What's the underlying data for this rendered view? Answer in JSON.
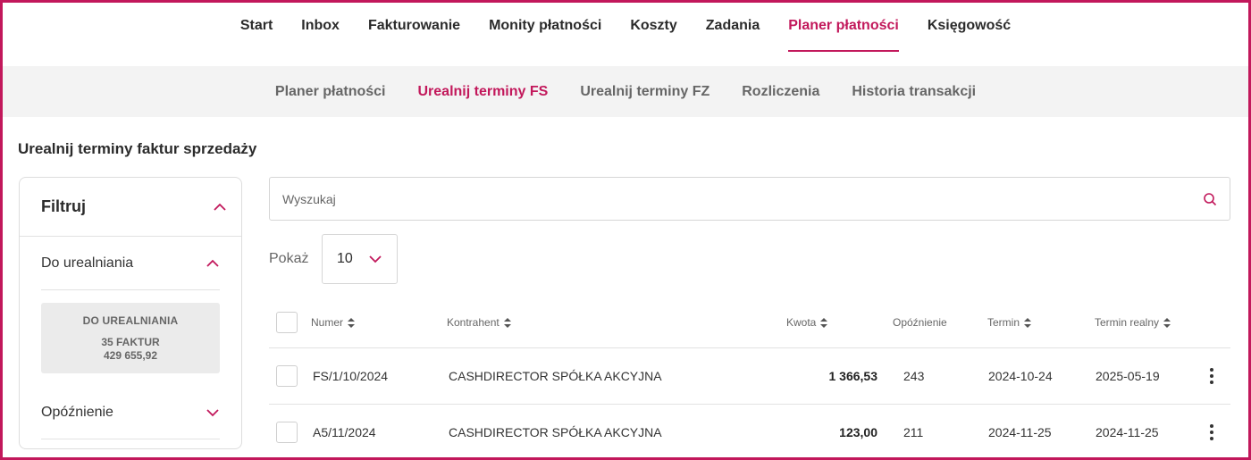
{
  "top_nav": [
    {
      "label": "Start"
    },
    {
      "label": "Inbox"
    },
    {
      "label": "Fakturowanie"
    },
    {
      "label": "Monity płatności"
    },
    {
      "label": "Koszty"
    },
    {
      "label": "Zadania"
    },
    {
      "label": "Planer płatności",
      "active": true
    },
    {
      "label": "Księgowość"
    }
  ],
  "sub_nav": [
    {
      "label": "Planer płatności"
    },
    {
      "label": "Urealnij terminy FS",
      "active": true
    },
    {
      "label": "Urealnij terminy FZ"
    },
    {
      "label": "Rozliczenia"
    },
    {
      "label": "Historia transakcji"
    }
  ],
  "page_title": "Urealnij terminy faktur sprzedaży",
  "filter": {
    "title": "Filtruj",
    "sections": {
      "do_urealniania": {
        "label": "Do urealniania",
        "expanded": true
      },
      "opoznienie": {
        "label": "Opóźnienie",
        "expanded": false
      }
    },
    "summary": {
      "title": "DO UREALNIANIA",
      "count": "35 FAKTUR",
      "amount": "429 655,92"
    }
  },
  "search": {
    "placeholder": "Wyszukaj",
    "value": "",
    "icon": "search-icon"
  },
  "page_size": {
    "label": "Pokaż",
    "value": "10"
  },
  "table": {
    "columns": {
      "number": "Numer",
      "contractor": "Kontrahent",
      "amount": "Kwota",
      "delay": "Opóźnienie",
      "term": "Termin",
      "real_term": "Termin realny"
    },
    "rows": [
      {
        "number": "FS/1/10/2024",
        "contractor": "CASHDIRECTOR SPÓŁKA AKCYJNA",
        "amount": "1 366,53",
        "delay": "243",
        "term": "2024-10-24",
        "real_term": "2025-05-19"
      },
      {
        "number": "A5/11/2024",
        "contractor": "CASHDIRECTOR SPÓŁKA AKCYJNA",
        "amount": "123,00",
        "delay": "211",
        "term": "2024-11-25",
        "real_term": "2024-11-25"
      }
    ]
  },
  "colors": {
    "accent": "#c2185b",
    "subnav_bg": "#f3f3f3",
    "summary_bg": "#ebebeb"
  }
}
